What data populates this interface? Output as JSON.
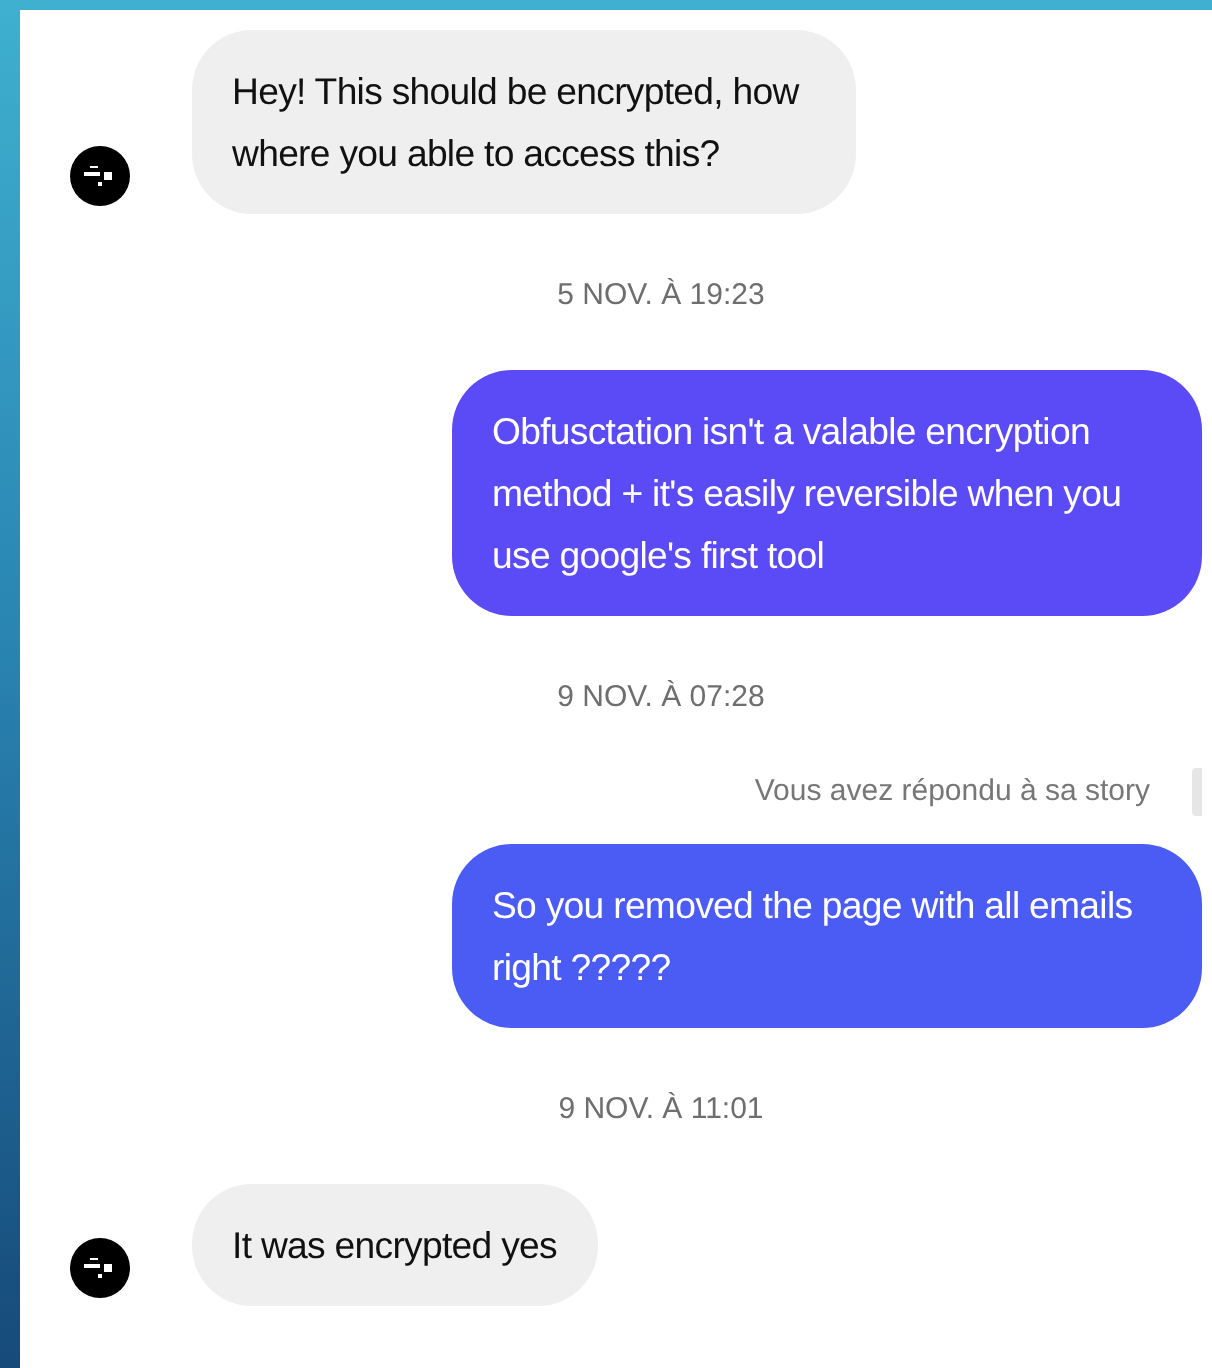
{
  "messages": [
    {
      "kind": "message",
      "outgoing": false,
      "text": "Hey! This should be encrypted, how where you able to access this?"
    },
    {
      "kind": "timestamp",
      "text": "5 NOV. À 19:23"
    },
    {
      "kind": "message",
      "outgoing": true,
      "color": "#5b4bf6",
      "text": "Obfusctation isn't a valable encryption method + it's easily reversible when you use google's first tool"
    },
    {
      "kind": "timestamp",
      "text": "9 NOV. À 07:28"
    },
    {
      "kind": "reply_note",
      "text": "Vous avez répondu à sa story"
    },
    {
      "kind": "message",
      "outgoing": true,
      "color": "#4a5cf4",
      "text": "So you removed the page with all emails right ?????"
    },
    {
      "kind": "timestamp",
      "text": "9 NOV. À 11:01"
    },
    {
      "kind": "message",
      "outgoing": false,
      "text": "It was encrypted yes"
    }
  ]
}
